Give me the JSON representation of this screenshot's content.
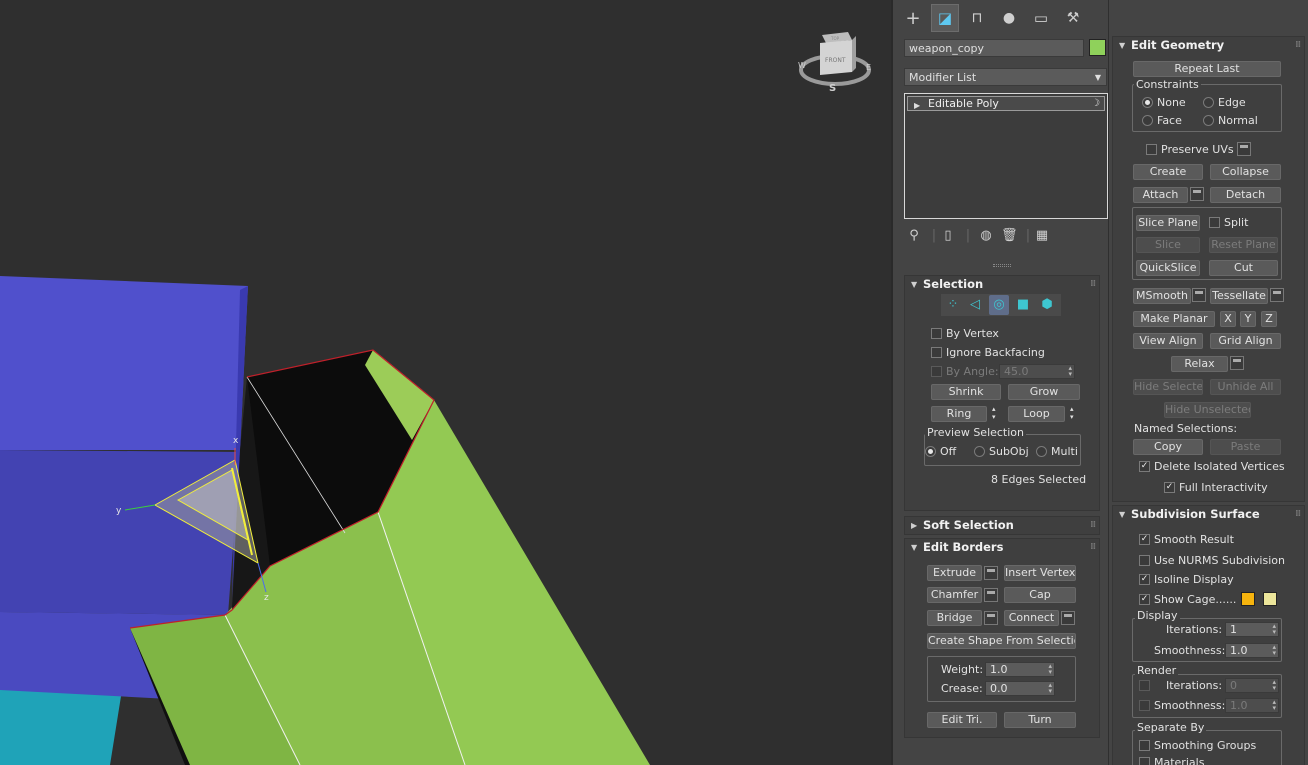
{
  "viewport": {
    "viewcube": {
      "face_label": "FRONT",
      "top_label": "TOP",
      "compass_s": "S",
      "compass_w": "W",
      "compass_e": "E"
    },
    "gizmo": {
      "x_label": "x",
      "y_label": "y",
      "z_label": "z"
    }
  },
  "command_panel": {
    "tabs": [
      {
        "name": "create-tab",
        "glyph": "+"
      },
      {
        "name": "modify-tab",
        "glyph": "◪"
      },
      {
        "name": "hierarchy-tab",
        "glyph": "⊓"
      },
      {
        "name": "motion-tab",
        "glyph": "●"
      },
      {
        "name": "display-tab",
        "glyph": "▭"
      },
      {
        "name": "utilities-tab",
        "glyph": "⚒"
      }
    ],
    "object_name": "weapon_copy",
    "object_color": "#8fd15b",
    "modifier_list": "Modifier List",
    "modifier_stack": [
      {
        "label": "Editable Poly"
      }
    ]
  },
  "selection": {
    "title": "Selection",
    "by_vertex": "By Vertex",
    "ignore_backfacing": "Ignore Backfacing",
    "by_angle": "By Angle:",
    "by_angle_value": "45.0",
    "shrink": "Shrink",
    "grow": "Grow",
    "ring": "Ring",
    "loop": "Loop",
    "preview_selection": "Preview Selection",
    "preview_off": "Off",
    "preview_subobj": "SubObj",
    "preview_multi": "Multi",
    "status": "8 Edges Selected"
  },
  "soft_selection": {
    "title": "Soft Selection"
  },
  "edit_borders": {
    "title": "Edit Borders",
    "extrude": "Extrude",
    "insert_vertex": "Insert Vertex",
    "chamfer": "Chamfer",
    "cap": "Cap",
    "bridge": "Bridge",
    "connect": "Connect",
    "create_shape": "Create Shape From Selection",
    "weight_label": "Weight:",
    "weight_value": "1.0",
    "crease_label": "Crease:",
    "crease_value": "0.0",
    "edit_tri": "Edit Tri.",
    "turn": "Turn"
  },
  "edit_geometry": {
    "title": "Edit Geometry",
    "repeat_last": "Repeat Last",
    "constraints": "Constraints",
    "none": "None",
    "edge": "Edge",
    "face": "Face",
    "normal": "Normal",
    "preserve_uvs": "Preserve UVs",
    "create": "Create",
    "collapse": "Collapse",
    "attach": "Attach",
    "detach": "Detach",
    "slice_plane": "Slice Plane",
    "split": "Split",
    "slice": "Slice",
    "reset_plane": "Reset Plane",
    "quickslice": "QuickSlice",
    "cut": "Cut",
    "msmooth": "MSmooth",
    "tessellate": "Tessellate",
    "make_planar": "Make Planar",
    "x": "X",
    "y": "Y",
    "z": "Z",
    "view_align": "View Align",
    "grid_align": "Grid Align",
    "relax": "Relax",
    "hide_selected": "Hide Selected",
    "unhide_all": "Unhide All",
    "hide_unselected": "Hide Unselected",
    "named_selections": "Named Selections:",
    "copy": "Copy",
    "paste": "Paste",
    "delete_isolated": "Delete Isolated Vertices",
    "full_interactivity": "Full Interactivity"
  },
  "subdivision_surface": {
    "title": "Subdivision Surface",
    "smooth_result": "Smooth Result",
    "use_nurms": "Use NURMS Subdivision",
    "isoline_display": "Isoline Display",
    "show_cage": "Show Cage......",
    "cage_color_1": "#f6b40e",
    "cage_color_2": "#ece59a",
    "display": "Display",
    "iterations_label": "Iterations:",
    "display_iterations": "1",
    "smoothness_label": "Smoothness:",
    "display_smoothness": "1.0",
    "render": "Render",
    "render_iterations": "0",
    "render_smoothness": "1.0",
    "separate_by": "Separate By",
    "smoothing_groups": "Smoothing Groups",
    "materials": "Materials"
  }
}
